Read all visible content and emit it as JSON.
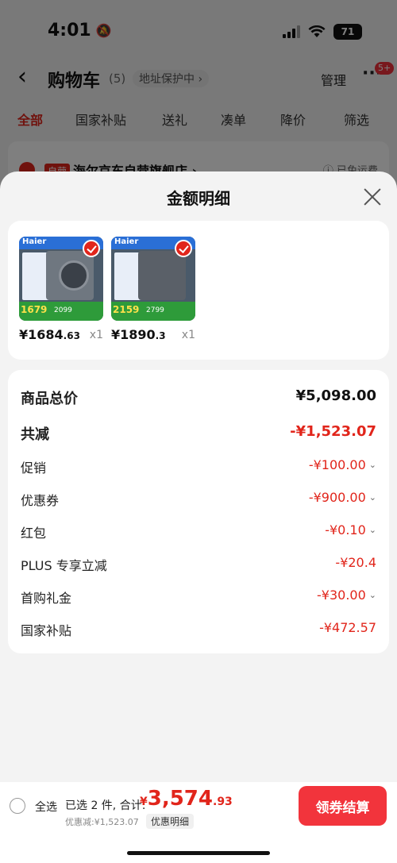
{
  "status": {
    "time": "4:01",
    "battery": "71"
  },
  "nav": {
    "back_icon": "chevron-left-icon",
    "title": "购物车",
    "count": "(5)",
    "address": "地址保护中 ›",
    "manage": "管理",
    "more": "···",
    "badge": "5+"
  },
  "tabs": [
    "全部",
    "国家补贴",
    "送礼",
    "凑单",
    "降价",
    "筛选"
  ],
  "store": {
    "tag": "自营",
    "name": "海尔京东自营旗舰店 ›",
    "shipping": "ⓘ 已免运费"
  },
  "sheet": {
    "title": "金额明细",
    "close_icon": "close-icon"
  },
  "products": [
    {
      "brand": "Haier",
      "badge_price": "1679",
      "badge_price2": "2099",
      "price_int": "¥1684",
      "price_dec": ".63",
      "qty": "x1"
    },
    {
      "brand": "Haier",
      "badge_price": "2159",
      "badge_price2": "2799",
      "price_int": "¥1890",
      "price_dec": ".3",
      "qty": "x1"
    }
  ],
  "summary": [
    {
      "label": "商品总价",
      "value": "¥5,098.00"
    },
    {
      "label": "共减",
      "value": "-¥1,523.07"
    },
    {
      "label": "促销",
      "value": "-¥100.00"
    },
    {
      "label": "优惠券",
      "value": "-¥900.00"
    },
    {
      "label": "红包",
      "value": "-¥0.10"
    },
    {
      "label": "PLUS 专享立减",
      "value": "-¥20.4"
    },
    {
      "label": "首购礼金",
      "value": "-¥30.00"
    },
    {
      "label": "国家补贴",
      "value": "-¥472.57"
    }
  ],
  "colors": {
    "accent": "#e1251b",
    "checkout": "#f2343c"
  },
  "bottom": {
    "select_all": "全选",
    "selected": "已选 2 件, 合计:",
    "currency": "¥",
    "total_int": "3,574",
    "total_dec": ".93",
    "discount": "优惠减:¥1,523.07",
    "detail_link": "优惠明细",
    "checkout": "领券结算"
  }
}
